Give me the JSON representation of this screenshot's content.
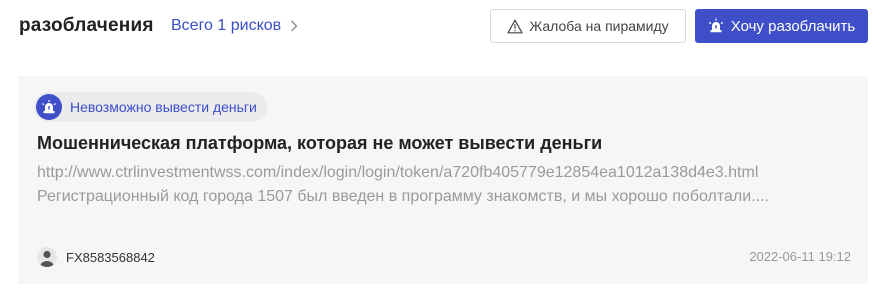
{
  "header": {
    "title": "разоблачения",
    "total_link": "Всего 1 рисков",
    "complaint_button": "Жалоба на пирамиду",
    "expose_button": "Хочу разоблачить"
  },
  "card": {
    "tag_label": "Невозможно вывести деньги",
    "title": "Мошенническая платформа, которая не может вывести деньги",
    "url": "http://www.ctrlinvestmentwss.com/index/login/login/token/a720fb405779e12854ea1012a138d4e3.html",
    "description": "Регистрационный код города 1507 был введен в программу знакомств, и мы хорошо поболтали....",
    "author": "FX8583568842",
    "date": "2022-06-11 19:12"
  },
  "colors": {
    "accent": "#3e4fc9",
    "link": "#3a4fc7",
    "muted_text": "#9a9a9a",
    "card_bg": "#f6f6f6"
  },
  "icons": {
    "total_link": "chevron-right-icon",
    "complaint_button": "warning-triangle-icon",
    "expose_button": "alarm-siren-icon",
    "tag": "alarm-siren-icon",
    "author": "user-avatar-icon"
  }
}
